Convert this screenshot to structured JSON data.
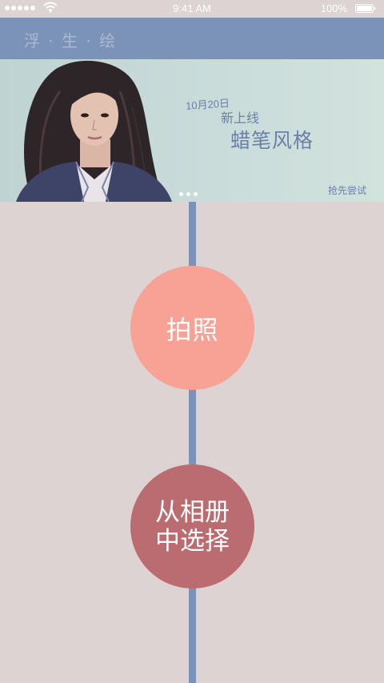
{
  "status_bar": {
    "time": "9:41 AM",
    "battery": "100%",
    "signal_icon": "signal-dots-icon",
    "wifi_icon": "wifi-icon",
    "battery_icon": "battery-icon"
  },
  "nav": {
    "title": "浮 · 生 · 绘"
  },
  "banner": {
    "date": "10月20日",
    "new_label": "新上线",
    "style_name": "蜡笔风格",
    "try_label": "抢先尝试",
    "page_count": 3
  },
  "actions": {
    "take_photo": "拍照",
    "choose_album": "从相册\n中选择"
  },
  "colors": {
    "background": "#ded3d3",
    "nav_bar": "#7b93b8",
    "timeline": "#7b93b8",
    "take_photo_button": "#f7a295",
    "album_button": "#bb6c70",
    "banner_text": "#6a80a8"
  }
}
